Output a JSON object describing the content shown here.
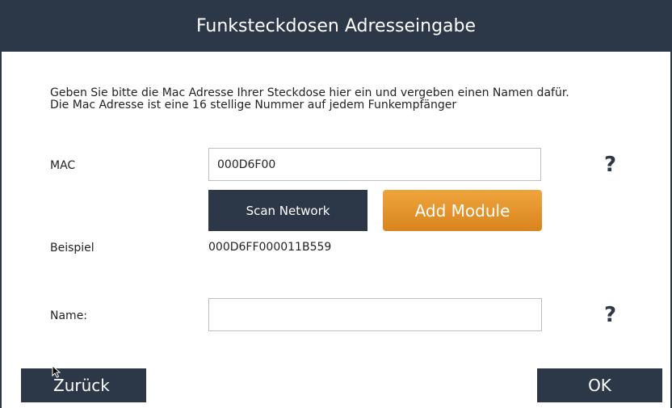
{
  "window": {
    "title": "Funksteckdosen Adresseingabe"
  },
  "instructions": {
    "line1": "Geben Sie bitte die Mac Adresse Ihrer Steckdose hier ein und vergeben einen Namen dafür.",
    "line2": "Die Mac Adresse ist eine 16 stellige Nummer auf jedem Funkempfänger"
  },
  "mac": {
    "label": "MAC",
    "value": "000D6F00",
    "help": "?"
  },
  "buttons": {
    "scan": "Scan Network",
    "add": "Add Module",
    "back": "Zurück",
    "ok": "OK"
  },
  "example": {
    "label": "Beispiel",
    "value": "000D6FF000011B559"
  },
  "name": {
    "label": "Name:",
    "value": "",
    "help": "?"
  },
  "colors": {
    "dark": "#2c3847",
    "accent": "#e3922b"
  }
}
